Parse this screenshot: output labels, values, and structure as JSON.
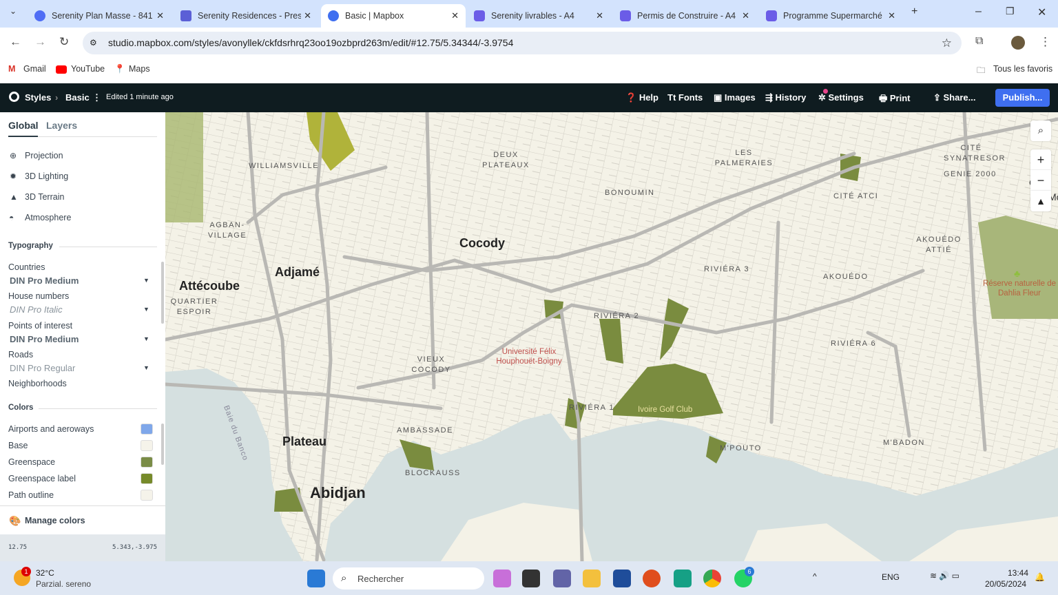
{
  "browser": {
    "tabs": [
      {
        "title": "Serenity Plan Masse - 841",
        "color": "#4f6df5"
      },
      {
        "title": "Serenity Residences - Prese",
        "color": "#5b5fd6"
      },
      {
        "title": "Basic | Mapbox",
        "color": "#3f6ff0",
        "active": true
      },
      {
        "title": "Serenity livrables - A4",
        "color": "#6b5ce7"
      },
      {
        "title": "Permis de Construire - A4",
        "color": "#6b5ce7"
      },
      {
        "title": "Programme Supermarché",
        "color": "#6b5ce7"
      }
    ],
    "url": "studio.mapbox.com/styles/avonyllek/ckfdsrhrq23oo19ozbprd263m/edit/#12.75/5.34344/-3.9754",
    "bookmarks": [
      "Gmail",
      "YouTube",
      "Maps"
    ],
    "all_bookmarks": "Tous les favoris"
  },
  "toolbar": {
    "styles": "Styles",
    "style_name": "Basic",
    "edited": "Edited 1 minute ago",
    "help": "Help",
    "fonts": "Fonts",
    "images": "Images",
    "history": "History",
    "settings": "Settings",
    "print": "Print",
    "share": "Share...",
    "publish": "Publish..."
  },
  "sidebar": {
    "tabs": [
      "Global",
      "Layers"
    ],
    "global_items": [
      "Projection",
      "3D Lighting",
      "3D Terrain",
      "Atmosphere"
    ],
    "typography_title": "Typography",
    "typography": [
      {
        "label": "Countries",
        "font": "DIN Pro Medium"
      },
      {
        "label": "House numbers",
        "font": "DIN Pro Italic"
      },
      {
        "label": "Points of interest",
        "font": "DIN Pro Medium"
      },
      {
        "label": "Roads",
        "font": "DIN Pro Regular"
      },
      {
        "label": "Neighborhoods",
        "font": "DIN Pro Regular"
      }
    ],
    "colors_title": "Colors",
    "colors": [
      {
        "label": "Airports and aeroways",
        "color": "#7fa7ea"
      },
      {
        "label": "Base",
        "color": "#f5f3ea"
      },
      {
        "label": "Greenspace",
        "color": "#7a8c47"
      },
      {
        "label": "Greenspace label",
        "color": "#768a2a"
      },
      {
        "label": "Path outline",
        "color": "#f5f3ea"
      }
    ],
    "manage_colors": "Manage colors",
    "zoom": "12.75",
    "coords": "5.343,-3.975"
  },
  "map": {
    "colors": {
      "land": "#f4f2e7",
      "water": "#d5e0e0",
      "green": "#7a8c3f",
      "road": "#b9b8b4"
    },
    "labels": {
      "cocody": "Cocody",
      "adjame": "Adjamé",
      "attecoube": "Attécoube",
      "plateau": "Plateau",
      "abidjan": "Abidjan",
      "williamsville": "WILLIAMSVILLE",
      "deux_plateaux": "DEUX PLATEAUX",
      "les_palmeraies": "LES PALMERAIES",
      "bonoumin": "BONOUMIN",
      "cite_synatresor": "CITÉ SYNATRESOR",
      "genie2000": "GENIE 2000",
      "cite_atci": "CITÉ ATCI",
      "agban": "AGBAN-VILLAGE",
      "riviera3": "RIVIÉRA 3",
      "akouedo_attie": "AKOUÉDO ATTIÉ",
      "akouedo": "AKOUÉDO",
      "quartier_espoir": "QUARTIER ESPOIR",
      "riviera2": "RIVIÉRA 2",
      "riviera6": "RIVIÉRA 6",
      "vieux_cocody": "VIEUX COCODY",
      "riviera1": "RIVIÉRA 1",
      "ambassade": "AMBASSADE",
      "mpouto": "M'POUTO",
      "mbadon": "M'BADON",
      "blockauss": "BLOCKAUSS",
      "baie_banco": "Baie du Banco",
      "ogr": "Ogr",
      "mo": "Mo",
      "universite": "Université Félix Houphouët-Boigny",
      "golf": "Ivoire Golf Club",
      "reserve": "Réserve naturelle de Dahlia Fleur"
    }
  },
  "taskbar": {
    "weather_temp": "32°C",
    "weather_desc": "Parzial. sereno",
    "weather_badge": "1",
    "search": "Rechercher",
    "lang": "ENG",
    "time": "13:44",
    "date": "20/05/2024",
    "whatsapp_badge": "6"
  }
}
